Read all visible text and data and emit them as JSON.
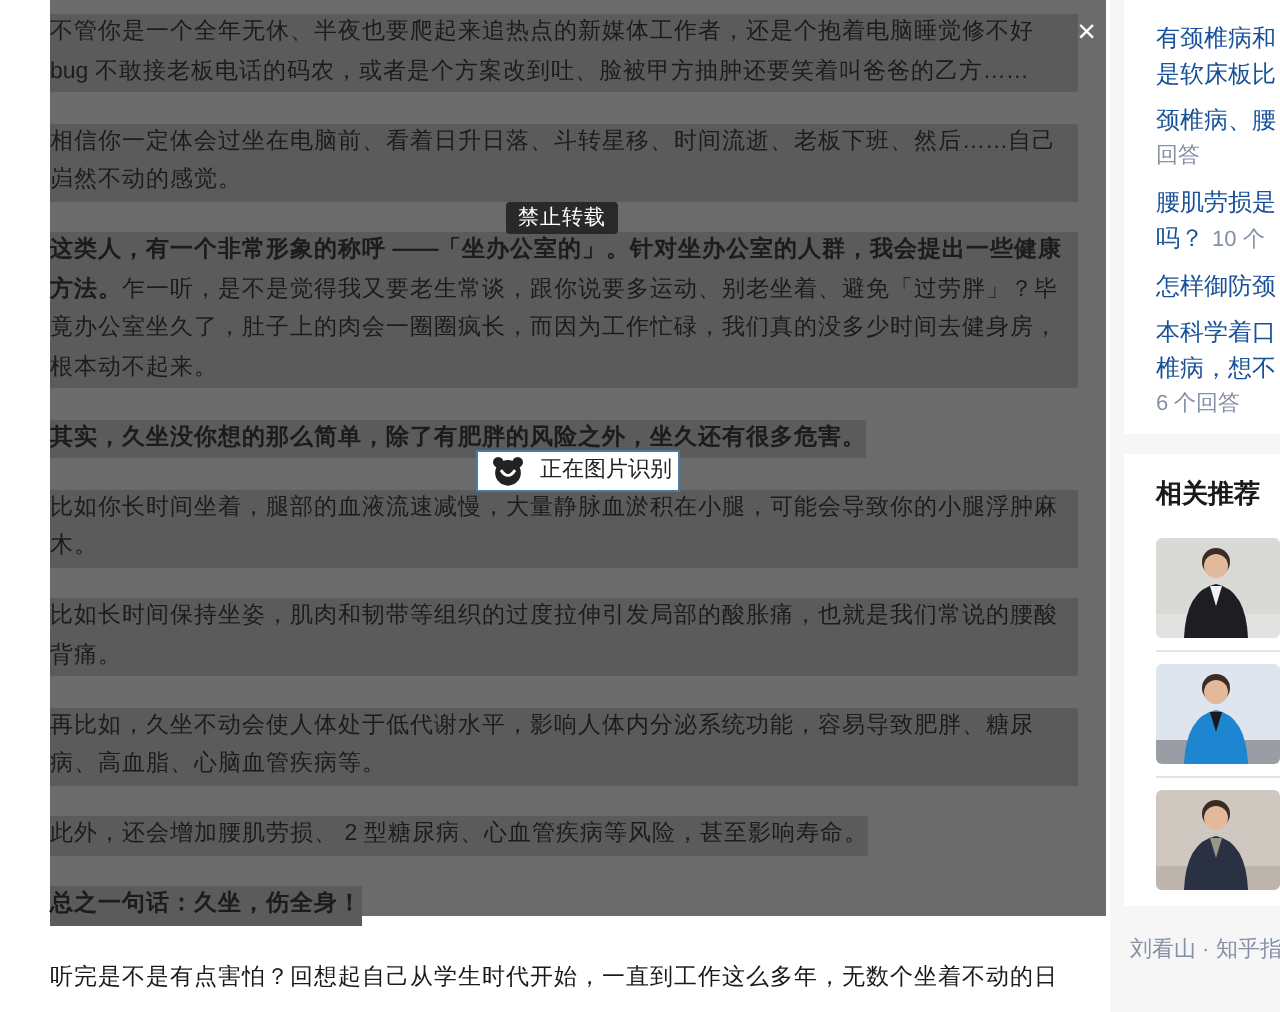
{
  "article": {
    "overlay": {
      "close": "×",
      "paragraphs": [
        {
          "text": "不管你是一个全年无休、半夜也要爬起来追热点的新媒体工作者，还是个抱着电脑睡觉修不好 bug 不敢接老板电话的码农，或者是个方案改到吐、脸被甲方抽肿还要笑着叫爸爸的乙方……",
          "bold": false
        },
        {
          "text": "相信你一定体会过坐在电脑前、看着日升日落、斗转星移、时间流逝、老板下班、然后……自己岿然不动的感觉。",
          "bold": false
        },
        {
          "text": "**这类人，有一个非常形象的称呼 ——「坐办公室的」。针对坐办公室的人群，我会提出一些健康方法。**乍一听，是不是觉得我又要老生常谈，跟你说要多运动、别老坐着、避免「过劳胖」？毕竟办公室坐久了，肚子上的肉会一圈圈疯长，而因为工作忙碌，我们真的没多少时间去健身房，根本动不起来。",
          "bold": false
        },
        {
          "text": "其实，久坐没你想的那么简单，除了有肥胖的风险之外，坐久还有很多危害。",
          "bold": true
        },
        {
          "text": "比如你长时间坐着，腿部的血液流速减慢，大量静脉血淤积在小腿，可能会导致你的小腿浮肿麻木。",
          "bold": false
        },
        {
          "text": "比如长时间保持坐姿，肌肉和韧带等组织的过度拉伸引发局部的酸胀痛，也就是我们常说的腰酸背痛。",
          "bold": false
        },
        {
          "text": "再比如，久坐不动会使人体处于低代谢水平，影响人体内分泌系统功能，容易导致肥胖、糖尿病、高血脂、心脑血管疾病等。",
          "bold": false
        },
        {
          "text": "此外，还会增加腰肌劳损、 2 型糖尿病、心血管疾病等风险，甚至影响寿命。",
          "bold": false
        },
        {
          "text": "总之一句话：久坐，伤全身！",
          "bold": true
        }
      ],
      "tooltip": "禁止转载",
      "toast": "正在图片识别"
    },
    "after_paragraph": "听完是不是有点害怕？回想起自己从学生时代开始，一直到工作这么多年，无数个坐着不动的日"
  },
  "sidebar": {
    "questions": [
      {
        "lines": [
          "有颈椎病和",
          "是软床板比"
        ]
      },
      {
        "lines": [
          "颈椎病、腰"
        ],
        "meta": "回答"
      },
      {
        "lines": [
          "腰肌劳损是"
        ],
        "tail": "吗？",
        "meta": "10 个"
      },
      {
        "lines": [
          "怎样御防颈"
        ]
      },
      {
        "lines": [
          "本科学着口",
          "椎病，想不"
        ],
        "meta": "6 个回答"
      }
    ],
    "related": {
      "title": "相关推荐"
    },
    "footer": "刘看山 · 知乎指"
  }
}
